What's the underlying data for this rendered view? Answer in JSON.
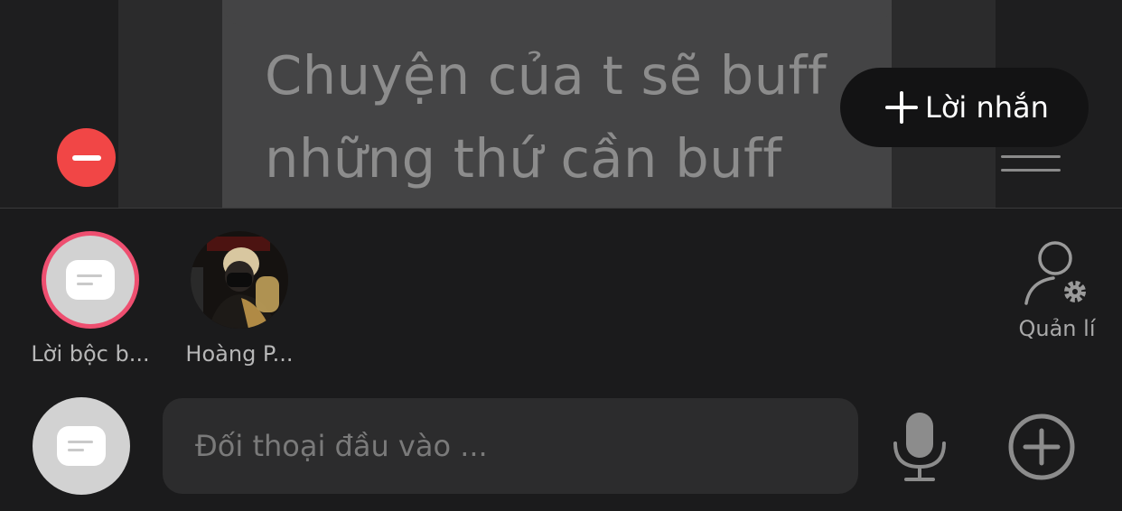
{
  "message_card": {
    "text": "Chuyện của t sẽ buff\nnhững thứ cần buff"
  },
  "toolbar": {
    "add_message_label": "Lời nhắn",
    "remove_icon": "minus-circle-icon",
    "add_icon": "plus-icon",
    "drag_icon": "drag-handle-icon"
  },
  "contacts": [
    {
      "label": "Lời bộc b...",
      "avatar": "chat-bubble-icon"
    },
    {
      "label": "Hoàng P...",
      "avatar": "profile-photo"
    }
  ],
  "manage": {
    "label": "Quản lí",
    "icon": "user-gear-icon"
  },
  "input_bar": {
    "placeholder": "Đối thoại đầu vào ...",
    "value": "",
    "mic_icon": "microphone-icon",
    "add_icon": "plus-circle-icon",
    "avatar_icon": "chat-bubble-icon"
  },
  "colors": {
    "background": "#1b1b1c",
    "card": "#444445",
    "remove": "#f14646",
    "ring": "#ee4f70"
  }
}
